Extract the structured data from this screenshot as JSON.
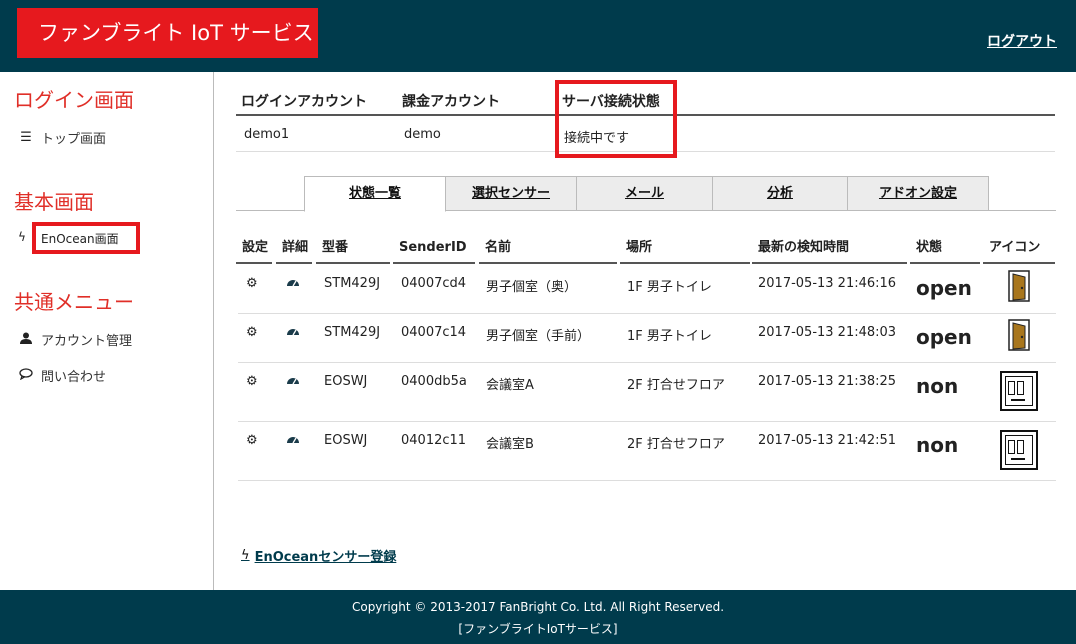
{
  "header": {
    "brand": "ファンブライト IoT サービス",
    "logout": "ログアウト"
  },
  "sidebar": {
    "login_heading": "ログイン画面",
    "top_item": "トップ画面",
    "basic_heading": "基本画面",
    "enocean_item": "EnOcean画面",
    "common_heading": "共通メニュー",
    "account_item": "アカウント管理",
    "contact_item": "問い合わせ"
  },
  "account": {
    "headers": [
      "ログインアカウント",
      "課金アカウント",
      "サーバ接続状態"
    ],
    "values": [
      "demo1",
      "demo",
      "接続中です"
    ]
  },
  "tabs": [
    "状態一覧",
    "選択センサー",
    "メール",
    "分析",
    "アドオン設定"
  ],
  "table": {
    "headers": [
      "設定",
      "詳細",
      "型番",
      "SenderID",
      "名前",
      "場所",
      "最新の検知時間",
      "状態",
      "アイコン"
    ],
    "rows": [
      {
        "model": "STM429J",
        "sender": "04007cd4",
        "name": "男子個室（奥）",
        "place": "1F 男子トイレ",
        "time": "2017-05-13 21:46:16",
        "state": "open",
        "icon": "door-open-icon"
      },
      {
        "model": "STM429J",
        "sender": "04007c14",
        "name": "男子個室（手前）",
        "place": "1F 男子トイレ",
        "time": "2017-05-13 21:48:03",
        "state": "open",
        "icon": "door-open-icon"
      },
      {
        "model": "EOSWJ",
        "sender": "0400db5a",
        "name": "会議室A",
        "place": "2F 打合せフロア",
        "time": "2017-05-13 21:38:25",
        "state": "non",
        "icon": "meeting-room-icon"
      },
      {
        "model": "EOSWJ",
        "sender": "04012c11",
        "name": "会議室B",
        "place": "2F 打合せフロア",
        "time": "2017-05-13 21:42:51",
        "state": "non",
        "icon": "meeting-room-icon"
      }
    ]
  },
  "register_link": "EnOceanセンサー登録",
  "footer": {
    "line1": "Copyright © 2013-2017 FanBright Co. Ltd. All Right Reserved.",
    "line2": "[ファンブライトIoTサービス]"
  },
  "colors": {
    "header_bg": "#003b4c",
    "accent_red": "#e6191e",
    "heading_red": "#e02f28"
  }
}
